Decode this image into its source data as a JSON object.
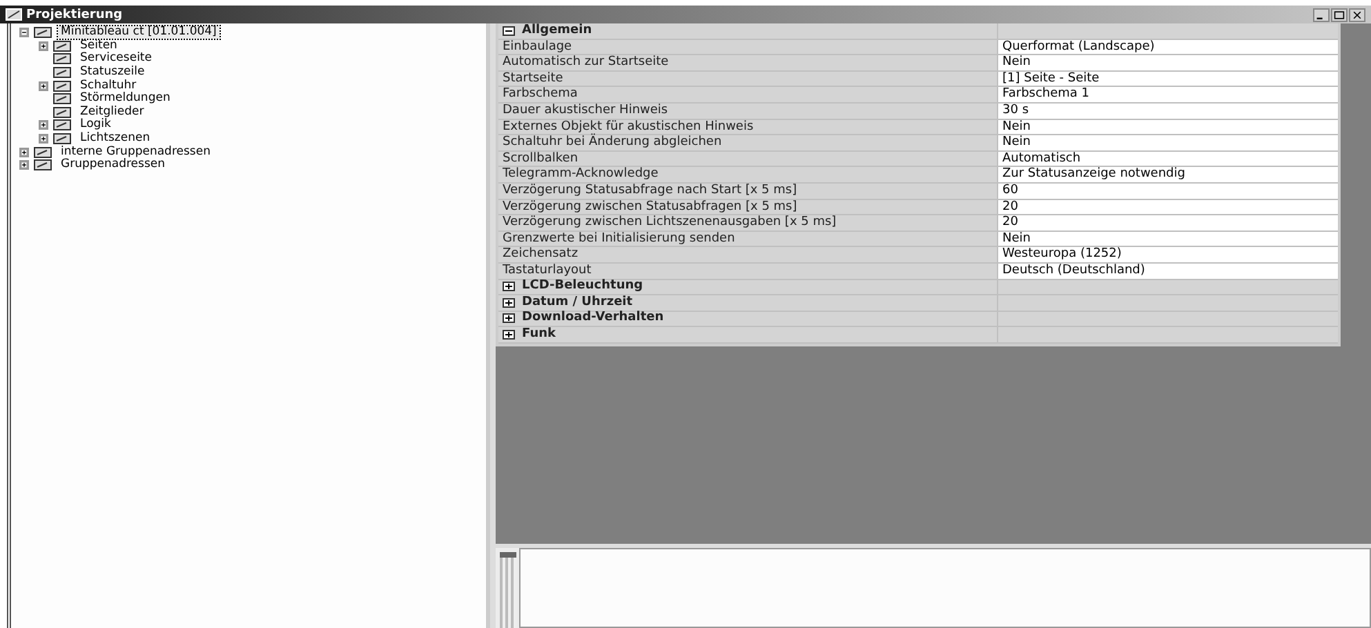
{
  "window": {
    "title": "Projektierung"
  },
  "tree": [
    {
      "label": "Minitableau ct [01.01.004]",
      "selected": true,
      "expanded": true,
      "children": [
        {
          "label": "Seiten",
          "selected": false,
          "expanded": false
        },
        {
          "label": "Serviceseite",
          "selected": false
        },
        {
          "label": "Statuszeile",
          "selected": false
        },
        {
          "label": "Schaltuhr",
          "selected": false,
          "expanded": false
        },
        {
          "label": "Störmeldungen",
          "selected": false
        },
        {
          "label": "Zeitglieder",
          "selected": false
        },
        {
          "label": "Logik",
          "selected": false,
          "expanded": false
        },
        {
          "label": "Lichtszenen",
          "selected": false,
          "expanded": false
        }
      ]
    },
    {
      "label": "interne Gruppenadressen",
      "selected": false,
      "expanded": false
    },
    {
      "label": "Gruppenadressen",
      "selected": false,
      "expanded": false
    }
  ],
  "properties": [
    {
      "title": "Allgemein",
      "expanded": true,
      "rows": [
        {
          "name": "Einbaulage",
          "value": "Querformat (Landscape)"
        },
        {
          "name": "Automatisch zur Startseite",
          "value": "Nein"
        },
        {
          "name": "Startseite",
          "value": "[1] Seite - Seite"
        },
        {
          "name": "Farbschema",
          "value": "Farbschema 1"
        },
        {
          "name": "Dauer akustischer Hinweis",
          "value": "30 s"
        },
        {
          "name": "Externes Objekt für akustischen Hinweis",
          "value": "Nein"
        },
        {
          "name": "Schaltuhr bei Änderung abgleichen",
          "value": "Nein"
        },
        {
          "name": "Scrollbalken",
          "value": "Automatisch"
        },
        {
          "name": "Telegramm-Acknowledge",
          "value": "Zur Statusanzeige notwendig"
        },
        {
          "name": "Verzögerung Statusabfrage nach Start [x 5 ms]",
          "value": "60"
        },
        {
          "name": "Verzögerung zwischen Statusabfragen [x 5 ms]",
          "value": "20"
        },
        {
          "name": "Verzögerung zwischen Lichtszenenausgaben [x 5 ms]",
          "value": "20"
        },
        {
          "name": "Grenzwerte bei Initialisierung senden",
          "value": "Nein"
        },
        {
          "name": "Zeichensatz",
          "value": "Westeuropa (1252)"
        },
        {
          "name": "Tastaturlayout",
          "value": "Deutsch (Deutschland)"
        }
      ]
    },
    {
      "title": "LCD-Beleuchtung",
      "expanded": false
    },
    {
      "title": "Datum / Uhrzeit",
      "expanded": false
    },
    {
      "title": "Download-Verhalten",
      "expanded": false
    },
    {
      "title": "Funk",
      "expanded": false
    }
  ]
}
